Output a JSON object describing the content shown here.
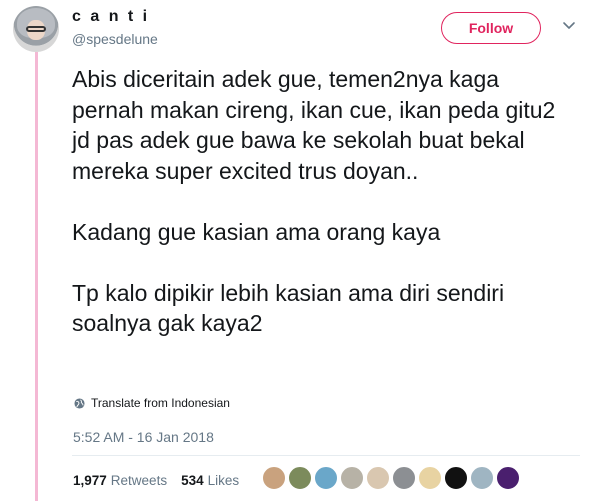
{
  "user": {
    "display_name": "c a n t i",
    "handle": "@spesdelune"
  },
  "actions": {
    "follow_label": "Follow"
  },
  "tweet": {
    "paragraphs": [
      "Abis diceritain adek gue, temen2nya kaga pernah makan cireng, ikan cue, ikan peda gitu2 jd pas adek gue bawa ke sekolah buat bekal mereka super excited trus doyan..",
      "Kadang gue kasian ama orang kaya",
      "Tp kalo dipikir lebih kasian ama diri sendiri soalnya gak kaya2"
    ],
    "translate_label": "Translate from Indonesian",
    "timestamp": "5:52 AM - 16 Jan 2018"
  },
  "stats": {
    "retweets_count": "1,977",
    "retweets_label": "Retweets",
    "likes_count": "534",
    "likes_label": "Likes"
  },
  "likers": [
    {
      "name": "liker-avatar",
      "color": "#c9a27e"
    },
    {
      "name": "liker-avatar",
      "color": "#7c8b5c"
    },
    {
      "name": "liker-avatar",
      "color": "#6aa7c9"
    },
    {
      "name": "liker-avatar",
      "color": "#b7b2a6"
    },
    {
      "name": "liker-avatar",
      "color": "#d9c7b0"
    },
    {
      "name": "liker-avatar",
      "color": "#8c8f93"
    },
    {
      "name": "liker-avatar",
      "color": "#e8d3a2"
    },
    {
      "name": "liker-avatar",
      "color": "#111111"
    },
    {
      "name": "liker-avatar",
      "color": "#9fb5c2"
    },
    {
      "name": "liker-avatar",
      "color": "#4a1f6e"
    }
  ],
  "colors": {
    "accent": "#e0245e",
    "thread_line": "#f4b8d4",
    "secondary_text": "#657786"
  }
}
